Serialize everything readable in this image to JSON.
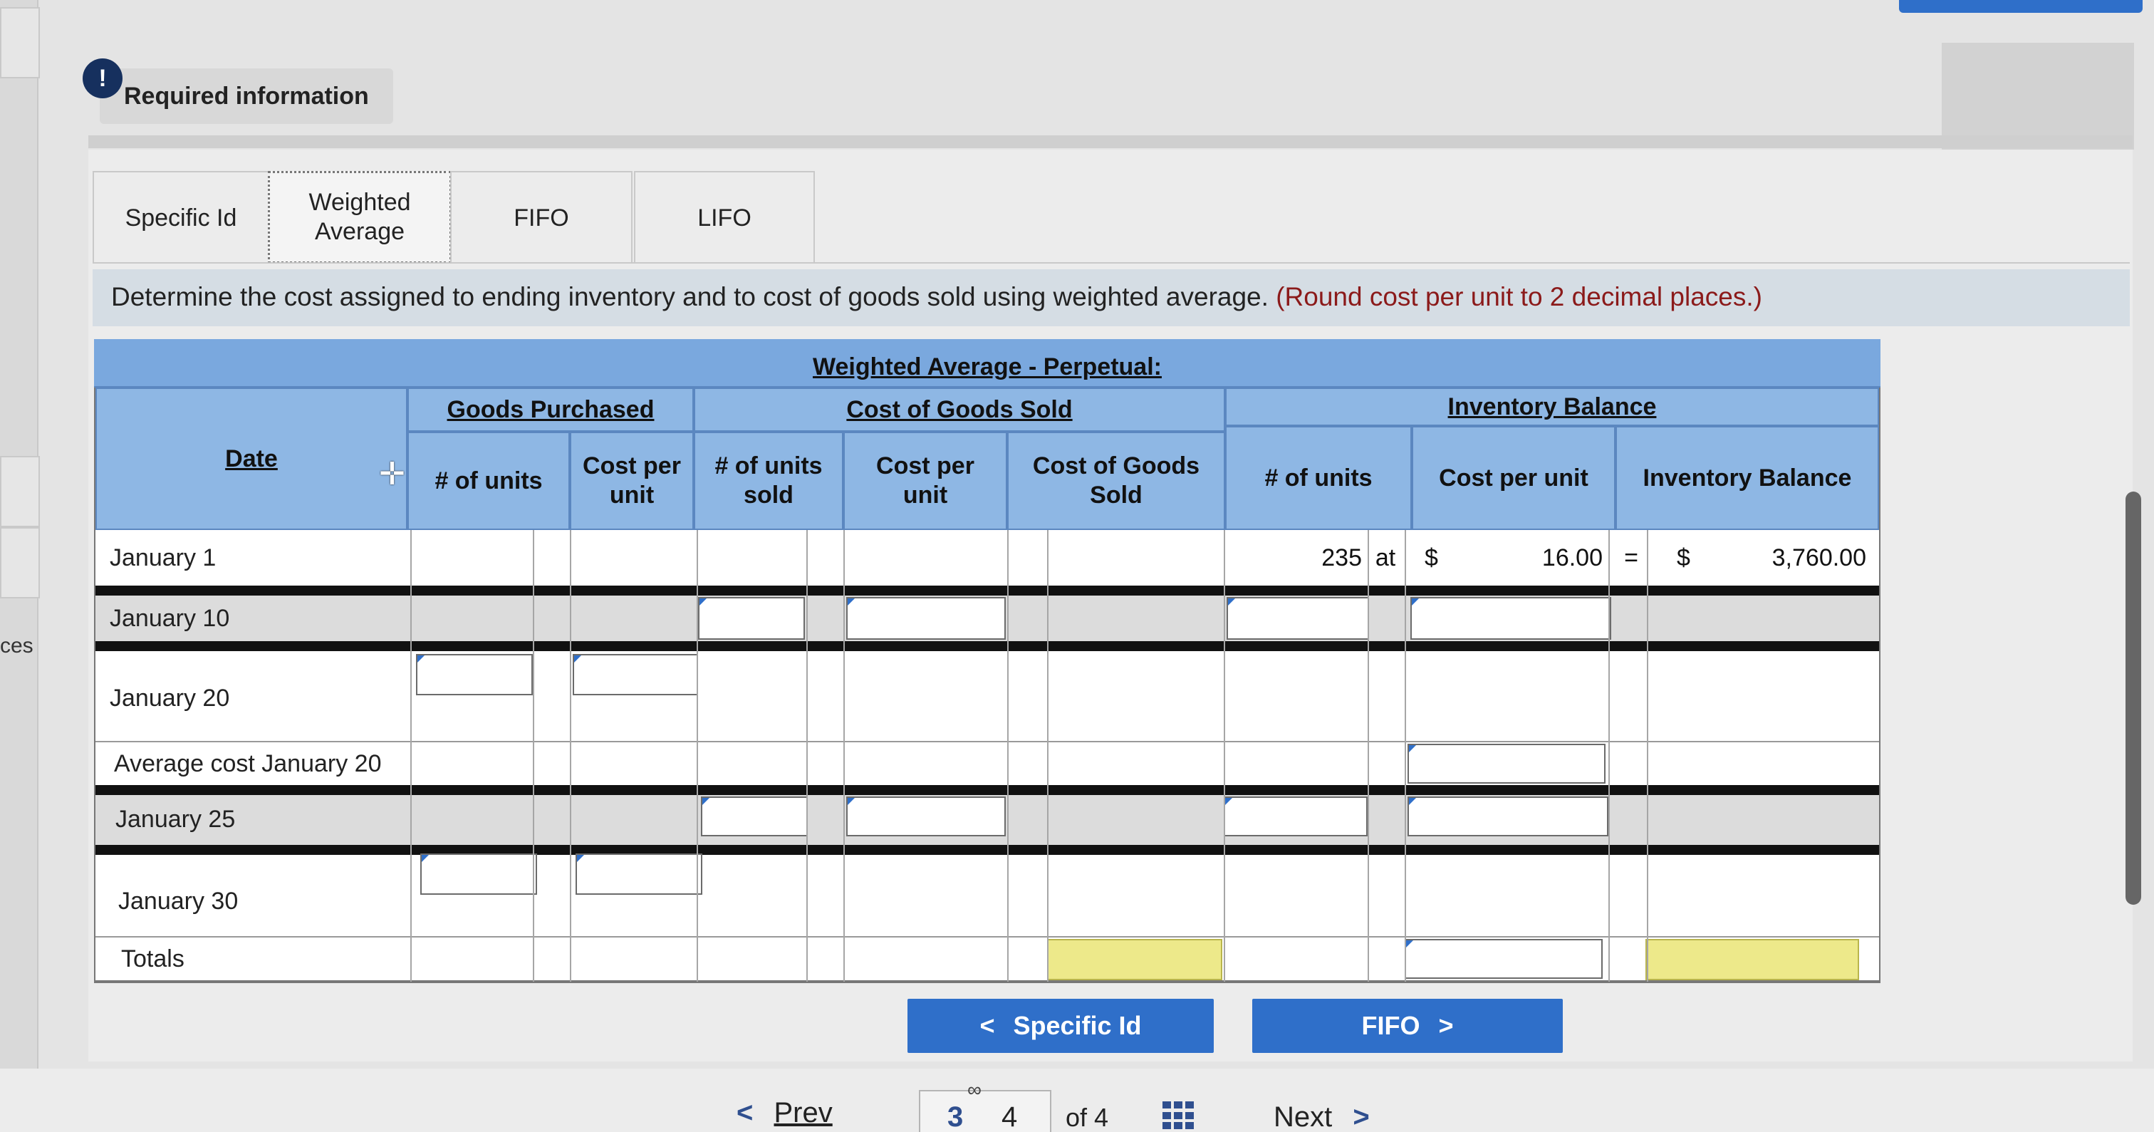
{
  "header": {
    "required_label": "Required information",
    "alert_icon": "exclamation-icon",
    "side_fragment": "ces"
  },
  "tabs": [
    {
      "label": "Specific Id",
      "active": false
    },
    {
      "label": "Weighted Average",
      "active": true
    },
    {
      "label": "FIFO",
      "active": false
    },
    {
      "label": "LIFO",
      "active": false
    }
  ],
  "instruction": {
    "text": "Determine the cost assigned to ending inventory and to cost of goods sold using weighted average.",
    "note": "(Round cost per unit to 2 decimal places.)"
  },
  "table": {
    "title": "Weighted Average - Perpetual:",
    "groups": {
      "purchased": "Goods Purchased",
      "cogs": "Cost of Goods Sold",
      "balance": "Inventory Balance"
    },
    "columns": {
      "date": "Date",
      "units": "# of units",
      "cost_per_unit": "Cost per unit",
      "units_sold": "# of units sold",
      "cogs_cost_per_unit": "Cost per unit",
      "cogs_total": "Cost of Goods Sold",
      "bal_units": "# of units",
      "bal_cost": "Cost per unit",
      "bal_total": "Inventory Balance"
    },
    "rows": [
      {
        "label": "January 1",
        "bal_units": "235",
        "at": "at",
        "dollar1": "$",
        "bal_cost": "16.00",
        "eq": "=",
        "dollar2": "$",
        "bal_total": "3,760.00"
      },
      {
        "label": "January 10"
      },
      {
        "label": "January 20"
      },
      {
        "label": "Average cost January 20"
      },
      {
        "label": "January 25"
      },
      {
        "label": "January 30"
      },
      {
        "label": "Totals"
      }
    ]
  },
  "nav": {
    "prev_tab": "Specific Id",
    "next_tab": "FIFO",
    "prev": "Prev",
    "next": "Next",
    "page_prev": "3",
    "page_current": "4",
    "page_of": "of 4"
  },
  "colors": {
    "header_blue": "#8eb7e4",
    "button_blue": "#2f6fc9",
    "total_yellow": "#ede98a"
  }
}
